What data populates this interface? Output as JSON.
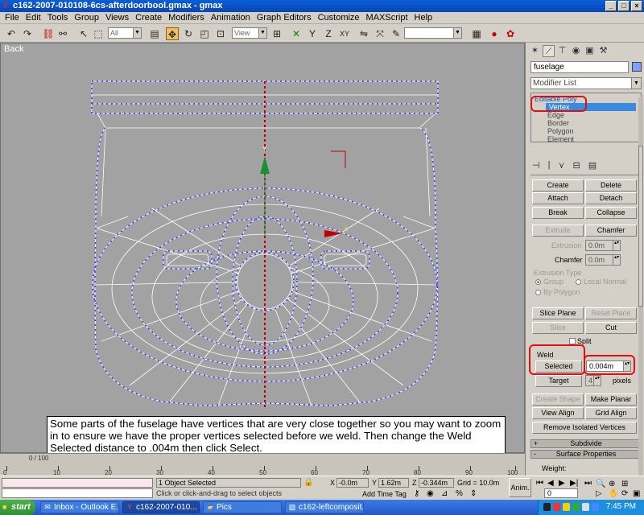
{
  "window": {
    "title": "c162-2007-010108-6cs-afterdoorbool.gmax - gmax",
    "controls": [
      "_",
      "□",
      "×"
    ]
  },
  "menu": [
    "File",
    "Edit",
    "Tools",
    "Group",
    "Views",
    "Create",
    "Modifiers",
    "Animation",
    "Graph Editors",
    "Customize",
    "MAXScript",
    "Help"
  ],
  "toolbar": {
    "selection_filter": "All",
    "ref_coord": "View",
    "named_selection": ""
  },
  "viewport": {
    "label": "Back",
    "background": "#a2a2a2",
    "wire_color": "#ffffff",
    "vertex_color": "#3a3aff",
    "seam_color": "#c00000"
  },
  "annotation": {
    "text": "Some parts of the fuselage have vertices that are very close together so you may want to zoom in to ensure we have the proper vertices selected before we weld. Then change the Weld Selected distance to .004m then click Select."
  },
  "command_panel": {
    "object_name": "fuselage",
    "object_color": "#80a0ff",
    "modifier_list": "Modifier List",
    "stack": {
      "root": "Editable Poly",
      "items": [
        "Vertex",
        "Edge",
        "Border",
        "Polygon",
        "Element"
      ],
      "selected": "Vertex"
    },
    "buttons": {
      "create": "Create",
      "delete": "Delete",
      "attach": "Attach",
      "detach": "Detach",
      "break": "Break",
      "collapse": "Collapse",
      "extrude": "Extrude",
      "chamfer": "Chamfer",
      "slice_plane": "Slice Plane",
      "reset_plane": "Reset Plane",
      "slice": "Slice",
      "cut": "Cut",
      "weld_selected": "Selected",
      "target": "Target",
      "create_shape": "Create Shape",
      "make_planar": "Make Planar",
      "view_align": "View Align",
      "grid_align": "Grid Align",
      "remove_isolated": "Remove Isolated Vertices"
    },
    "labels": {
      "extrusion": "Extrusion",
      "chamfer": "Chamfer",
      "extrusion_type": "Extrusion Type",
      "group": "Group",
      "local_normal": "Local Normal",
      "by_polygon": "By Polygon",
      "split": "Split",
      "weld": "Weld",
      "pixels": "pixels"
    },
    "values": {
      "extrusion": "0.0m",
      "chamfer": "0.0m",
      "weld_threshold": "0.004m",
      "target_pixels": "4"
    },
    "rollouts": {
      "subdivide": "Subdivide",
      "surface_properties": "Surface Properties",
      "weight": "Weight:"
    }
  },
  "timeline": {
    "slider_label": "0 / 100",
    "ticks": [
      "0",
      "10",
      "20",
      "30",
      "40",
      "50",
      "60",
      "70",
      "80",
      "90",
      "100"
    ]
  },
  "status": {
    "selection": "1 Object Selected",
    "prompt": "Click or click-and-drag to select objects",
    "x_label": "X",
    "x": "-0.0m",
    "y_label": "Y",
    "y": "1.62m",
    "z_label": "Z",
    "z": "-0.344m",
    "grid": "Grid = 10.0m",
    "add_time_tag": "Add Time Tag",
    "anim": "Anim.",
    "frame": "0"
  },
  "taskbar": {
    "start": "start",
    "tasks": [
      "Inbox - Outlook E...",
      "c162-2007-010...",
      "Pics",
      "c162-leftcomposit..."
    ],
    "active_task": 1,
    "clock": "7:45 PM"
  }
}
